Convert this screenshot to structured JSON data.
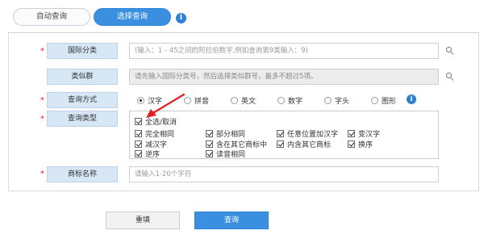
{
  "tabs": [
    {
      "label": "自动查询"
    },
    {
      "label": "选择查询"
    }
  ],
  "form": {
    "required_mark": "*",
    "intl_class": {
      "label": "国际分类",
      "placeholder": "(输入：1 - 45之间的阿拉伯数字,例如查询第9类输入：9)"
    },
    "similar_group": {
      "label": "类似群",
      "placeholder": "请先输入国际分类号，然后选择类似群号，最多不超过5项。"
    },
    "query_method": {
      "label": "查询方式",
      "options": [
        "汉字",
        "拼音",
        "英文",
        "数字",
        "字头",
        "图形"
      ],
      "selected": "汉字"
    },
    "query_type": {
      "label": "查询类型",
      "select_all": "全选/取消",
      "options": [
        "完全相同",
        "部分相同",
        "任意位置加汉字",
        "变汉字",
        "减汉字",
        "含在其它商标中",
        "内含其它商标",
        "换序",
        "逆序",
        "读音相同"
      ]
    },
    "trademark_name": {
      "label": "商标名称",
      "placeholder": "请输入1-20个字符"
    }
  },
  "buttons": {
    "reset": "重填",
    "query": "查询"
  },
  "icons": {
    "info": "i"
  },
  "colors": {
    "accent": "#3b8fe0",
    "label_bg": "#d7e7f6",
    "arrow": "#e02020",
    "required": "#e02020"
  }
}
